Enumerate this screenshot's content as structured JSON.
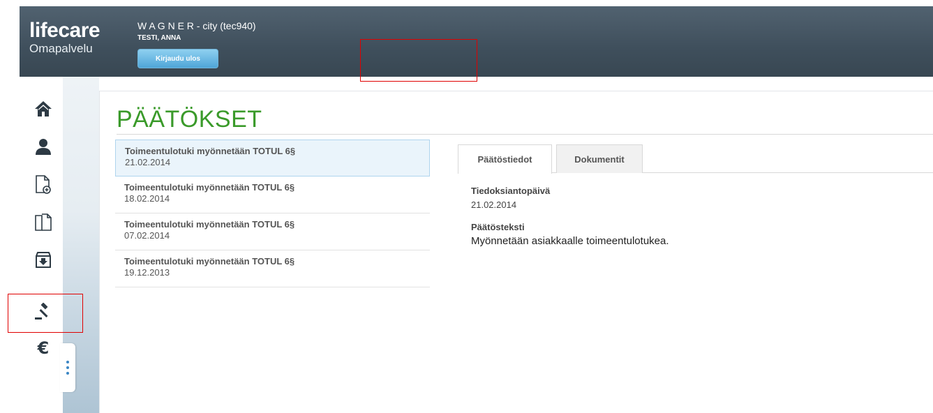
{
  "header": {
    "logo_main": "lifecare",
    "logo_sub": "Omapalvelu",
    "org_name": "W A G N E R - city (tec940)",
    "user_name": "TESTI, ANNA",
    "logout_label": "Kirjaudu ulos"
  },
  "sidebar": {
    "items": [
      {
        "name": "home",
        "icon": "home-icon"
      },
      {
        "name": "profile",
        "icon": "user-icon"
      },
      {
        "name": "new-document",
        "icon": "document-add-icon"
      },
      {
        "name": "documents",
        "icon": "documents-icon"
      },
      {
        "name": "inbox",
        "icon": "inbox-download-icon"
      },
      {
        "name": "decisions",
        "icon": "gavel-icon"
      },
      {
        "name": "payments",
        "icon": "euro-icon"
      }
    ],
    "more_icon": "vertical-dots-icon"
  },
  "page": {
    "title": "PÄÄTÖKSET"
  },
  "decisions": [
    {
      "title": "Toimeentulotuki myönnetään TOTUL 6§",
      "date": "21.02.2014"
    },
    {
      "title": "Toimeentulotuki myönnetään TOTUL 6§",
      "date": "18.02.2014"
    },
    {
      "title": "Toimeentulotuki myönnetään TOTUL 6§",
      "date": "07.02.2014"
    },
    {
      "title": "Toimeentulotuki myönnetään TOTUL 6§",
      "date": "19.12.2013"
    }
  ],
  "tabs": [
    {
      "label": "Päätöstiedot"
    },
    {
      "label": "Dokumentit"
    }
  ],
  "details": {
    "notice_date_label": "Tiedoksiantopäivä",
    "notice_date_value": "21.02.2014",
    "decision_text_label": "Päätösteksti",
    "decision_text_value": "Myönnetään asiakkaalle toimeentulotukea."
  },
  "colors": {
    "header_bg": "#3f4f5c",
    "title_green": "#3a9a2a",
    "logout_blue": "#4fa6d8",
    "highlight_red": "#e00000",
    "selected_row": "#eaf4fb"
  }
}
